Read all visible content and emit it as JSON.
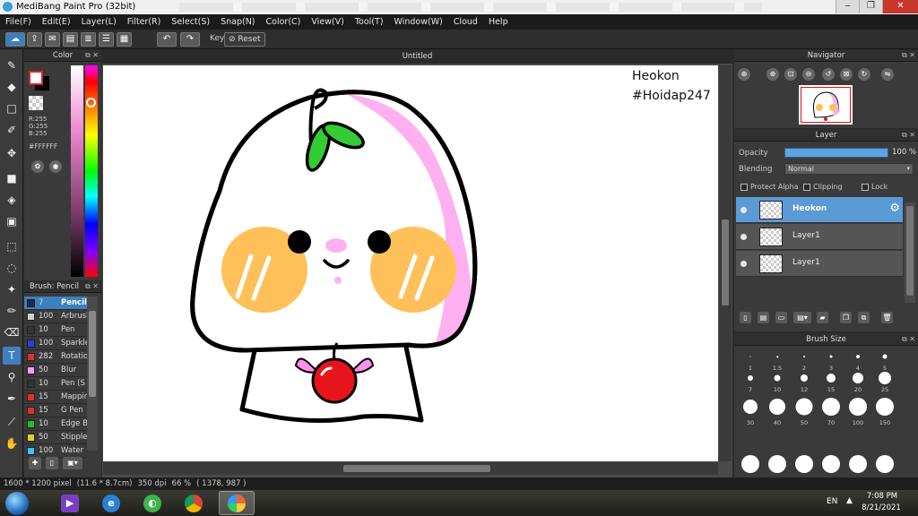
{
  "window": {
    "title": "MediBang Paint Pro (32bit)",
    "buttons": [
      "‒",
      "❐",
      "✕"
    ]
  },
  "menu": [
    "File(F)",
    "Edit(E)",
    "Layer(L)",
    "Filter(R)",
    "Select(S)",
    "Snap(N)",
    "Color(C)",
    "View(V)",
    "Tool(T)",
    "Window(W)",
    "Cloud",
    "Help"
  ],
  "toolbar": {
    "key_label": "Key",
    "reset_label": "Reset"
  },
  "color_panel": {
    "title": "Color",
    "r": "R:255",
    "g": "G:255",
    "b": "B:255",
    "hex": "#FFFFFF",
    "foreground": "#ffffff",
    "background": "#000000"
  },
  "brush_panel": {
    "title": "Brush: Pencil",
    "items": [
      {
        "size": "7",
        "name": "Pencil",
        "color": "#1a2a55",
        "selected": true
      },
      {
        "size": "100",
        "name": "Arbrush",
        "color": "#cfcfcf"
      },
      {
        "size": "10",
        "name": "Pen",
        "color": "#333333"
      },
      {
        "size": "100",
        "name": "Sparkle",
        "color": "#2a3fe0"
      },
      {
        "size": "282",
        "name": "Rotation",
        "color": "#e03030"
      },
      {
        "size": "50",
        "name": "Blur",
        "color": "#f4a0f0"
      },
      {
        "size": "10",
        "name": "Pen (S",
        "color": "#333333"
      },
      {
        "size": "15",
        "name": "Mappin",
        "color": "#e03030"
      },
      {
        "size": "15",
        "name": "G Pen",
        "color": "#e03030"
      },
      {
        "size": "10",
        "name": "Edge B",
        "color": "#20c020"
      },
      {
        "size": "50",
        "name": "Stipple",
        "color": "#e0d020"
      },
      {
        "size": "100",
        "name": "Water",
        "color": "#40c0f0"
      }
    ]
  },
  "canvas": {
    "tab_title": "Untitled",
    "watermark_line1": "Heokon",
    "watermark_line2": "#Hoidap247"
  },
  "status": {
    "pixels": "1600 * 1200 pixel",
    "physical": "(11.6 * 8.7cm)",
    "dpi": "350 dpi",
    "zoom": "66 %",
    "coords": "( 1378, 987 )"
  },
  "navigator": {
    "title": "Navigator"
  },
  "layer_panel": {
    "title": "Layer",
    "opacity_label": "Opacity",
    "opacity_value": "100 %",
    "opacity_fraction": 1.0,
    "blending_label": "Blending",
    "blending_value": "Normal",
    "protect_alpha": "Protect Alpha",
    "clipping": "Clipping",
    "lock": "Lock",
    "layers": [
      {
        "name": "Heokon",
        "selected": true
      },
      {
        "name": "Layer1"
      },
      {
        "name": "Layer1"
      }
    ]
  },
  "brush_size": {
    "title": "Brush Size",
    "sizes": [
      "1",
      "1.5",
      "2",
      "3",
      "4",
      "5",
      "7",
      "10",
      "12",
      "15",
      "20",
      "25",
      "30",
      "40",
      "50",
      "70",
      "100",
      "150"
    ]
  },
  "taskbar": {
    "lang": "EN",
    "time": "7:08 PM",
    "date": "8/21/2021"
  },
  "colors": {
    "accent": "#3d7fbf",
    "layer_selected": "#5b9bd5",
    "cheek": "#ffc05a",
    "pink": "#ffb0f0",
    "leaf": "#33cc33",
    "apple": "#e8141c"
  }
}
